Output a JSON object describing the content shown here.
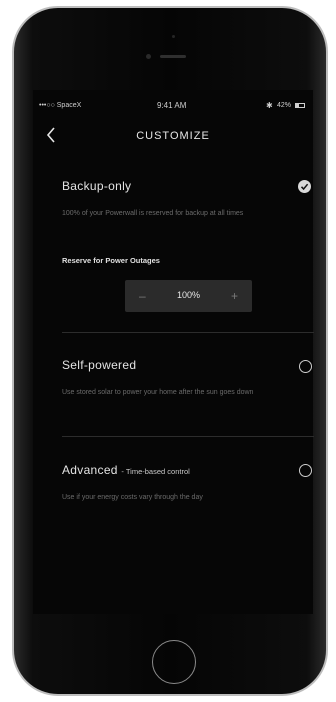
{
  "status_bar": {
    "carrier": "•••○○ SpaceX",
    "time": "9:41 AM",
    "battery_percent": "42%",
    "battery_level": 0.42
  },
  "nav": {
    "back_icon": "chevron-left-icon",
    "title": "CUSTOMIZE"
  },
  "options": {
    "backup": {
      "title": "Backup-only",
      "description": "100% of your Powerwall is reserved for backup at all times",
      "selected": true
    },
    "reserve": {
      "label": "Reserve for Power Outages",
      "minus": "–",
      "value": "100%",
      "plus": "+"
    },
    "self_powered": {
      "title": "Self-powered",
      "description": "Use stored solar to power your home after the sun goes down",
      "selected": false
    },
    "advanced": {
      "title": "Advanced",
      "subtitle": "- Time-based control",
      "description": "Use if your energy costs vary through the day",
      "selected": false
    }
  }
}
